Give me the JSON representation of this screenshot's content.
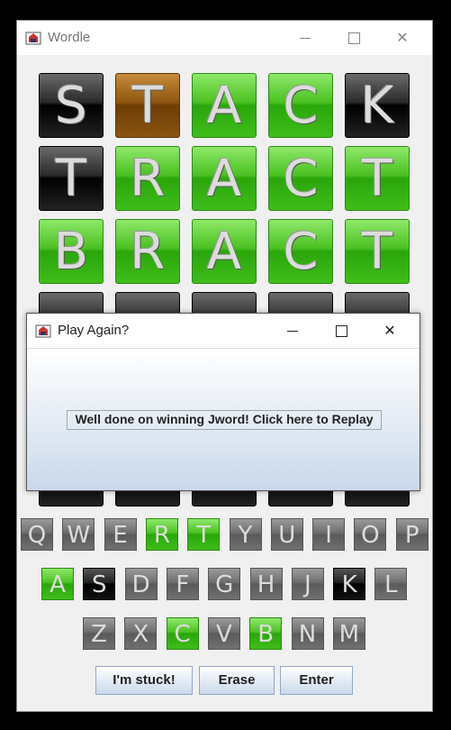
{
  "window": {
    "title": "Wordle"
  },
  "board": {
    "rows": [
      [
        {
          "letter": "S",
          "state": "gray"
        },
        {
          "letter": "T",
          "state": "yellow"
        },
        {
          "letter": "A",
          "state": "green"
        },
        {
          "letter": "C",
          "state": "green"
        },
        {
          "letter": "K",
          "state": "gray"
        }
      ],
      [
        {
          "letter": "T",
          "state": "gray"
        },
        {
          "letter": "R",
          "state": "green"
        },
        {
          "letter": "A",
          "state": "green"
        },
        {
          "letter": "C",
          "state": "green"
        },
        {
          "letter": "T",
          "state": "green"
        }
      ],
      [
        {
          "letter": "B",
          "state": "green"
        },
        {
          "letter": "R",
          "state": "green"
        },
        {
          "letter": "A",
          "state": "green"
        },
        {
          "letter": "C",
          "state": "green"
        },
        {
          "letter": "T",
          "state": "green"
        }
      ]
    ]
  },
  "keyboard": {
    "row1": [
      {
        "k": "Q",
        "s": "default"
      },
      {
        "k": "W",
        "s": "default"
      },
      {
        "k": "E",
        "s": "default"
      },
      {
        "k": "R",
        "s": "green"
      },
      {
        "k": "T",
        "s": "green"
      },
      {
        "k": "Y",
        "s": "default"
      },
      {
        "k": "U",
        "s": "default"
      },
      {
        "k": "I",
        "s": "default"
      },
      {
        "k": "O",
        "s": "default"
      },
      {
        "k": "P",
        "s": "default"
      }
    ],
    "row2": [
      {
        "k": "A",
        "s": "green"
      },
      {
        "k": "S",
        "s": "black"
      },
      {
        "k": "D",
        "s": "default"
      },
      {
        "k": "F",
        "s": "default"
      },
      {
        "k": "G",
        "s": "default"
      },
      {
        "k": "H",
        "s": "default"
      },
      {
        "k": "J",
        "s": "default"
      },
      {
        "k": "K",
        "s": "black"
      },
      {
        "k": "L",
        "s": "default"
      }
    ],
    "row3": [
      {
        "k": "Z",
        "s": "default"
      },
      {
        "k": "X",
        "s": "default"
      },
      {
        "k": "C",
        "s": "green"
      },
      {
        "k": "V",
        "s": "default"
      },
      {
        "k": "B",
        "s": "green"
      },
      {
        "k": "N",
        "s": "default"
      },
      {
        "k": "M",
        "s": "default"
      }
    ]
  },
  "buttons": {
    "stuck": "I'm stuck!",
    "erase": "Erase",
    "enter": "Enter"
  },
  "dialog": {
    "title": "Play Again?",
    "message": "Well done on winning Jword! Click here to Replay"
  },
  "icons": {
    "app": "java-cup-icon",
    "minimize": "minimize-icon",
    "maximize": "maximize-icon",
    "close": "close-icon"
  }
}
